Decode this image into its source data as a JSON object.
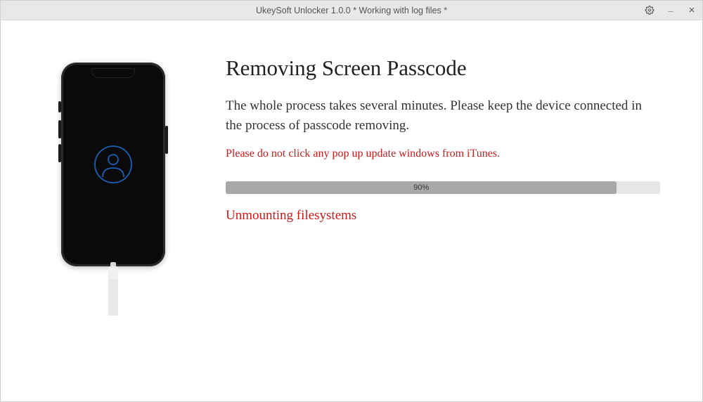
{
  "titlebar": {
    "title": "UkeySoft Unlocker 1.0.0 * Working with log files *"
  },
  "main": {
    "heading": "Removing Screen Passcode",
    "description": "The whole process takes several minutes. Please keep the device connected in the process of passcode removing.",
    "warning": "Please do not click any pop up update windows from iTunes.",
    "progress_percent": 90,
    "progress_label": "90%",
    "status": "Unmounting filesystems"
  }
}
